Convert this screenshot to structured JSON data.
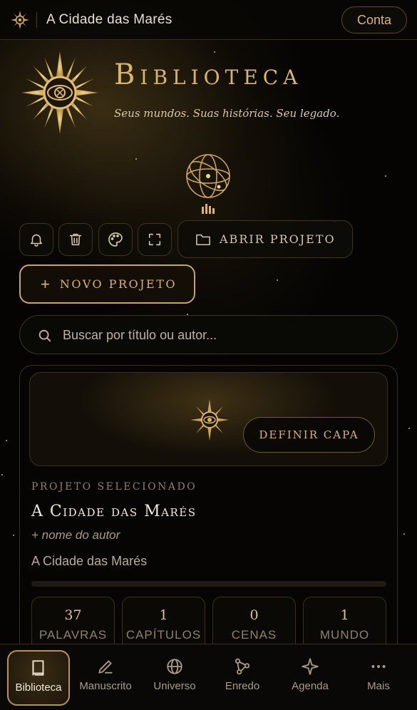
{
  "topbar": {
    "project_title": "A Cidade das Marés",
    "account_label": "Conta"
  },
  "hero": {
    "title": "Biblioteca",
    "subtitle": "Seus mundos. Suas histórias. Seu legado."
  },
  "toolbar": {
    "icons": [
      "bell-icon",
      "trash-icon",
      "palette-icon",
      "fullscreen-icon"
    ],
    "open_project_label": "ABRIR PROJETO",
    "new_project_label": "NOVO PROJETO"
  },
  "search": {
    "placeholder": "Buscar por título ou autor..."
  },
  "project": {
    "set_cover_label": "DEFINIR CAPA",
    "selected_label": "PROJETO SELECIONADO",
    "title": "A Cidade das Marés",
    "author_placeholder": "+ nome do autor",
    "description": "A Cidade das Marés",
    "progress": 0,
    "stats": [
      {
        "value": "37",
        "label": "PALAVRAS"
      },
      {
        "value": "1",
        "label": "CAPÍTULOS"
      },
      {
        "value": "0",
        "label": "CENAS"
      },
      {
        "value": "1",
        "label": "MUNDO"
      }
    ]
  },
  "nav": {
    "items": [
      {
        "label": "Biblioteca",
        "icon": "book-icon",
        "active": true
      },
      {
        "label": "Manuscrito",
        "icon": "pen-icon",
        "active": false
      },
      {
        "label": "Universo",
        "icon": "globe-icon",
        "active": false
      },
      {
        "label": "Enredo",
        "icon": "graph-icon",
        "active": false
      },
      {
        "label": "Agenda",
        "icon": "sparkle-icon",
        "active": false
      },
      {
        "label": "Mais",
        "icon": "more-icon",
        "active": false
      }
    ]
  },
  "colors": {
    "accent_gold": "#d8b468",
    "background": "#050403"
  }
}
